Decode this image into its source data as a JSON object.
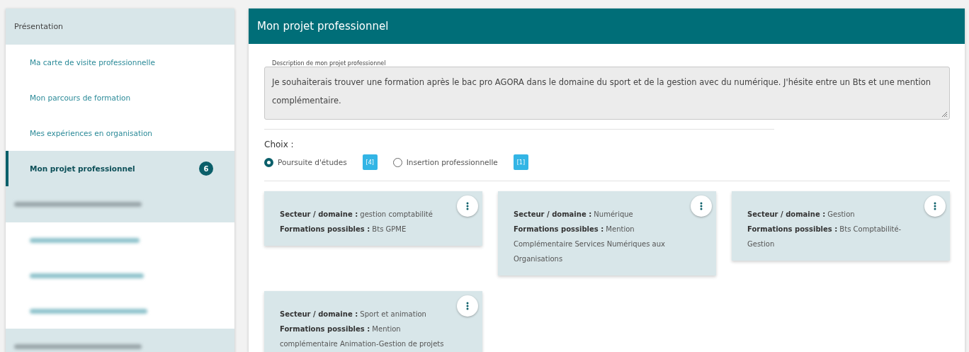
{
  "sidebar": {
    "sections": [
      {
        "kind": "text",
        "title": "Présentation",
        "items": [
          {
            "kind": "text",
            "label": "Ma carte de visite professionnelle",
            "selected": false
          },
          {
            "kind": "text",
            "label": "Mon parcours de formation",
            "selected": false
          },
          {
            "kind": "text",
            "label": "Mes expériences en organisation",
            "selected": false
          },
          {
            "kind": "text",
            "label": "Mon projet professionnel",
            "selected": true,
            "badge": "6"
          }
        ]
      },
      {
        "kind": "blurred",
        "items": [
          {
            "kind": "blurred"
          },
          {
            "kind": "blurred"
          },
          {
            "kind": "blurred"
          }
        ]
      },
      {
        "kind": "blurred"
      }
    ]
  },
  "main": {
    "title": "Mon projet professionnel",
    "description": {
      "label": "Description de mon projet professionnel",
      "value": "Je souhaiterais trouver une formation après le bac pro AGORA dans le domaine du sport et de la gestion avec du numérique.  J'hésite entre un Bts et une mention complémentaire."
    },
    "choice": {
      "label": "Choix :",
      "options": [
        {
          "label": "Poursuite d'études",
          "selected": true,
          "count": "[4]"
        },
        {
          "label": "Insertion professionnelle",
          "selected": false,
          "count": "[1]"
        }
      ]
    },
    "cards": [
      {
        "sector_label": "Secteur / domaine :",
        "sector": "gestion comptabilité",
        "training_label": "Formations possibles :",
        "training": "Bts GPME"
      },
      {
        "sector_label": "Secteur / domaine :",
        "sector": "Numérique",
        "training_label": "Formations possibles :",
        "training": "Mention Complémentaire Services Numériques aux Organisations"
      },
      {
        "sector_label": "Secteur / domaine :",
        "sector": "Gestion",
        "training_label": "Formations possibles :",
        "training": "Bts Comptabilité-Gestion"
      },
      {
        "sector_label": "Secteur / domaine :",
        "sector": "Sport et animation",
        "training_label": "Formations possibles :",
        "training": "Mention complémentaire Animation-Gestion de projets"
      }
    ]
  }
}
